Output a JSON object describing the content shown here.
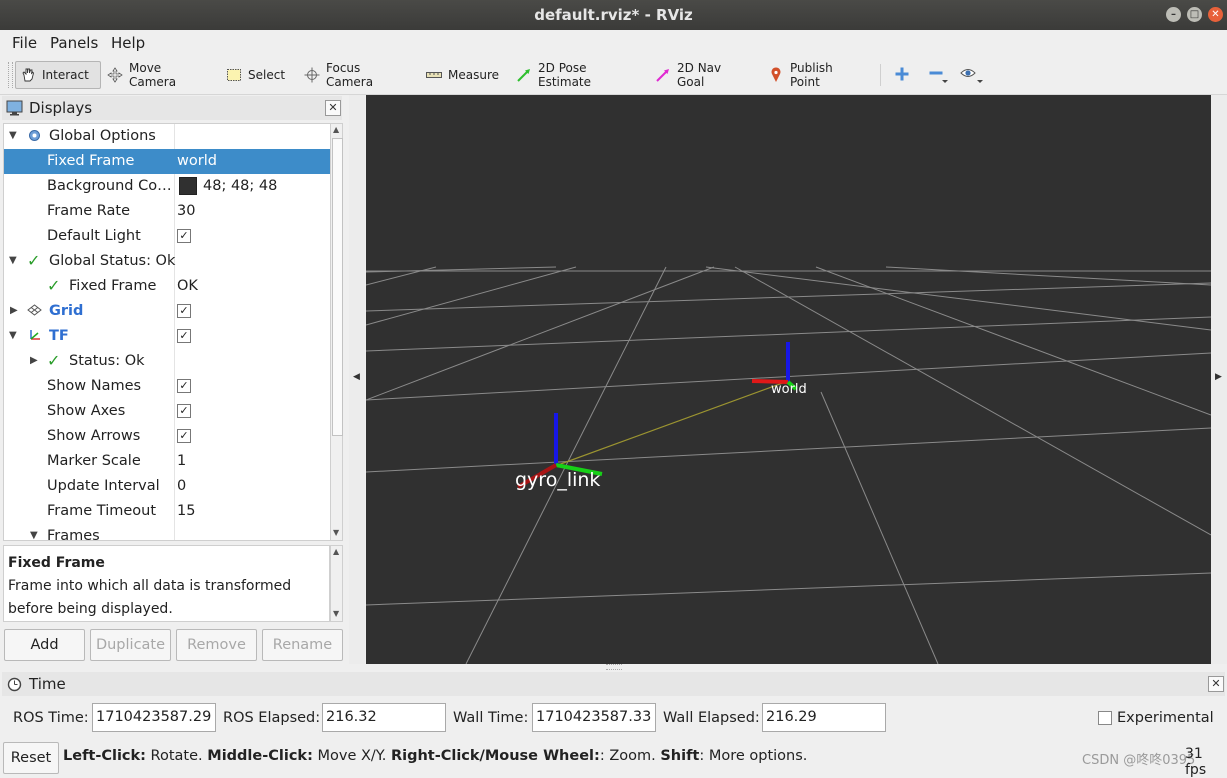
{
  "window": {
    "title": "default.rviz* - RViz"
  },
  "menu": [
    "File",
    "Panels",
    "Help"
  ],
  "toolbar": {
    "tools": [
      {
        "label": "Interact",
        "icon": "hand-icon"
      },
      {
        "label": "Move Camera",
        "icon": "move-camera-icon"
      },
      {
        "label": "Select",
        "icon": "select-icon"
      },
      {
        "label": "Focus Camera",
        "icon": "focus-camera-icon"
      },
      {
        "label": "Measure",
        "icon": "ruler-icon"
      },
      {
        "label": "2D Pose Estimate",
        "icon": "pose-estimate-arrow-icon"
      },
      {
        "label": "2D Nav Goal",
        "icon": "nav-goal-arrow-icon"
      },
      {
        "label": "Publish Point",
        "icon": "map-pin-icon"
      }
    ]
  },
  "displays": {
    "title": "Displays",
    "rows": [
      {
        "label": "Global Options",
        "value": ""
      },
      {
        "label": "Fixed Frame",
        "value": "world"
      },
      {
        "label": "Background Co…",
        "value": "48; 48; 48"
      },
      {
        "label": "Frame Rate",
        "value": "30"
      },
      {
        "label": "Default Light",
        "value": ""
      },
      {
        "label": "Global Status: Ok",
        "value": ""
      },
      {
        "label": "Fixed Frame",
        "value": "OK"
      },
      {
        "label": "Grid",
        "value": ""
      },
      {
        "label": "TF",
        "value": ""
      },
      {
        "label": "Status: Ok",
        "value": ""
      },
      {
        "label": "Show Names",
        "value": ""
      },
      {
        "label": "Show Axes",
        "value": ""
      },
      {
        "label": "Show Arrows",
        "value": ""
      },
      {
        "label": "Marker Scale",
        "value": "1"
      },
      {
        "label": "Update Interval",
        "value": "0"
      },
      {
        "label": "Frame Timeout",
        "value": "15"
      },
      {
        "label": "Frames",
        "value": ""
      }
    ],
    "background_color": "#303030",
    "description": {
      "title": "Fixed Frame",
      "line1": "Frame into which all data is transformed",
      "line2": "before being displayed."
    },
    "buttons": [
      "Add",
      "Duplicate",
      "Remove",
      "Rename"
    ]
  },
  "view": {
    "frames": [
      {
        "name": "world"
      },
      {
        "name": "gyro_link"
      }
    ]
  },
  "time": {
    "title": "Time",
    "ros_time_label": "ROS Time:",
    "ros_time": "1710423587.29",
    "ros_elapsed_label": "ROS Elapsed:",
    "ros_elapsed": "216.32",
    "wall_time_label": "Wall Time:",
    "wall_time": "1710423587.33",
    "wall_elapsed_label": "Wall Elapsed:",
    "wall_elapsed": "216.29",
    "experimental_label": "Experimental"
  },
  "status": {
    "reset_label": "Reset",
    "left_click_key": "Left-Click:",
    "left_click_desc": " Rotate. ",
    "middle_click_key": "Middle-Click:",
    "middle_click_desc": " Move X/Y. ",
    "right_click_key": "Right-Click/Mouse Wheel:",
    "right_click_desc": ": Zoom. ",
    "shift_key": "Shift",
    "shift_desc": ": More options.",
    "fps": "31 fps"
  },
  "watermark": "CSDN @咚咚0395"
}
